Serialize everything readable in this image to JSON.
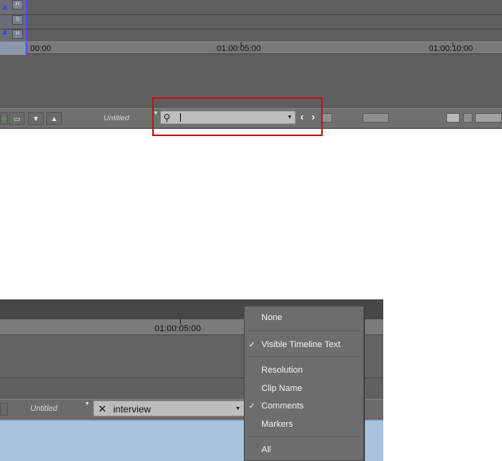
{
  "top_panel": {
    "track_buttons": [
      "H",
      "S",
      "H"
    ],
    "timecodes": [
      "00:00",
      "01:00:05:00",
      "01:00:10:00"
    ],
    "sequence_name": "Untitled",
    "find_field": {
      "value": "",
      "placeholder": ""
    }
  },
  "bottom_panel": {
    "timecode": "01:00:05:00",
    "sequence_name": "Untitled",
    "find_field": {
      "value": "interview",
      "clear_glyph": "✕"
    }
  },
  "menu": {
    "items": [
      {
        "label": "None",
        "checked": false
      },
      {
        "label": "Visible Timeline Text",
        "checked": true
      },
      {
        "label": "Resolution",
        "checked": false
      },
      {
        "label": "Clip Name",
        "checked": false
      },
      {
        "label": "Comments",
        "checked": true
      },
      {
        "label": "Markers",
        "checked": false
      },
      {
        "label": "All",
        "checked": false
      }
    ],
    "check_glyph": "✓"
  },
  "colors": {
    "highlight_box": "#c01818",
    "panel_gray": "#5f5f5f",
    "track_accent": "#4d5bd2",
    "selection_blue": "#a9c3dd"
  }
}
